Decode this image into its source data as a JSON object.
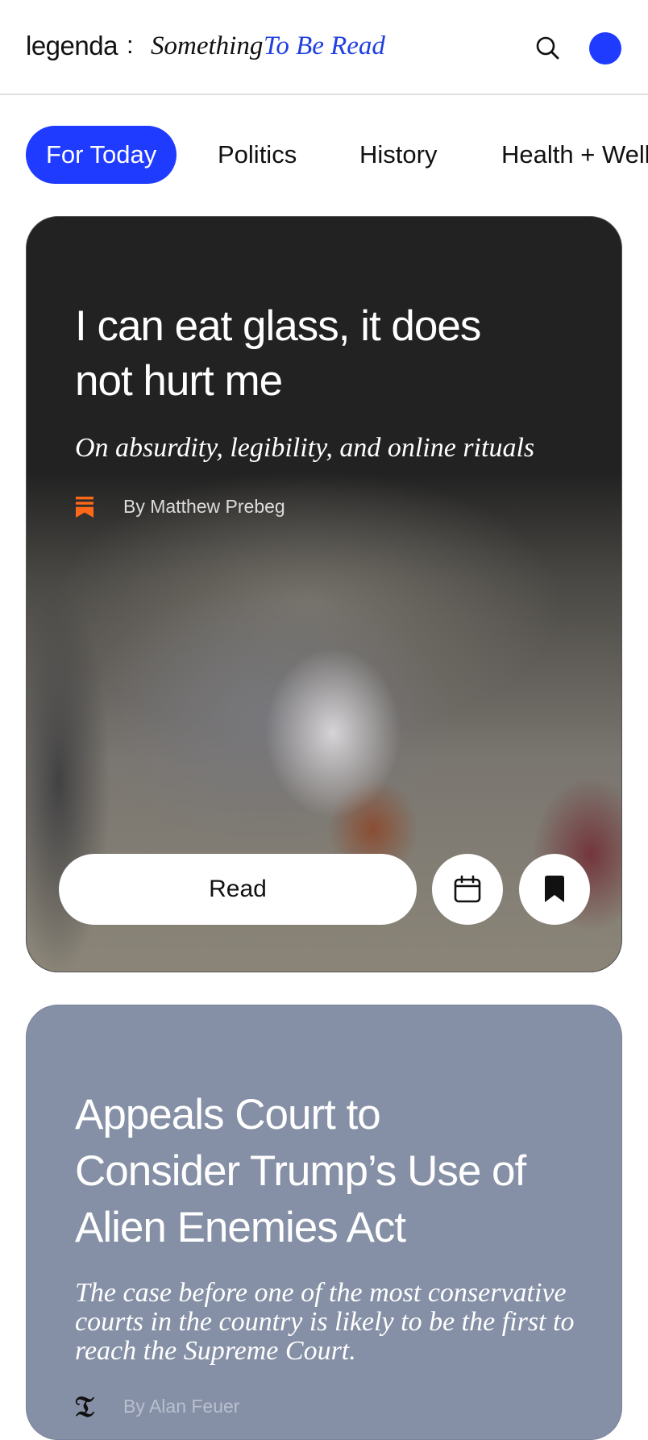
{
  "header": {
    "logo": "legenda",
    "separator": ":",
    "tagline_part1": "Something",
    "tagline_part2": "To Be Read",
    "search_icon": "search-icon",
    "avatar_color": "#1e3bff"
  },
  "tabs": [
    {
      "label": "For Today",
      "active": true
    },
    {
      "label": "Politics",
      "active": false
    },
    {
      "label": "History",
      "active": false
    },
    {
      "label": "Health + Well",
      "active": false
    }
  ],
  "cards": [
    {
      "title_line1": "I can eat glass, it does",
      "title_line2": "not hurt me",
      "subtitle": "On absurdity, legibility, and online rituals",
      "byline": "By Matthew Prebeg",
      "source_icon": "substack-icon",
      "source_color": "#ff6719",
      "read_label": "Read",
      "calendar_icon": "calendar-icon",
      "bookmark_icon": "bookmark-icon"
    },
    {
      "title_line1": "Appeals Court to",
      "title_line2": "Consider Trump’s Use of",
      "title_line3": "Alien Enemies Act",
      "subtitle_line1": "The case before one of the most conservative",
      "subtitle_line2": "courts in the country is likely to be the first to",
      "subtitle_line3": "reach the Supreme Court.",
      "byline": "By Alan Feuer",
      "source_icon": "nyt-logo-icon",
      "background": "#8590a6"
    }
  ],
  "colors": {
    "accent": "#1e3bff",
    "tagline_accent": "#1f3fe0"
  }
}
